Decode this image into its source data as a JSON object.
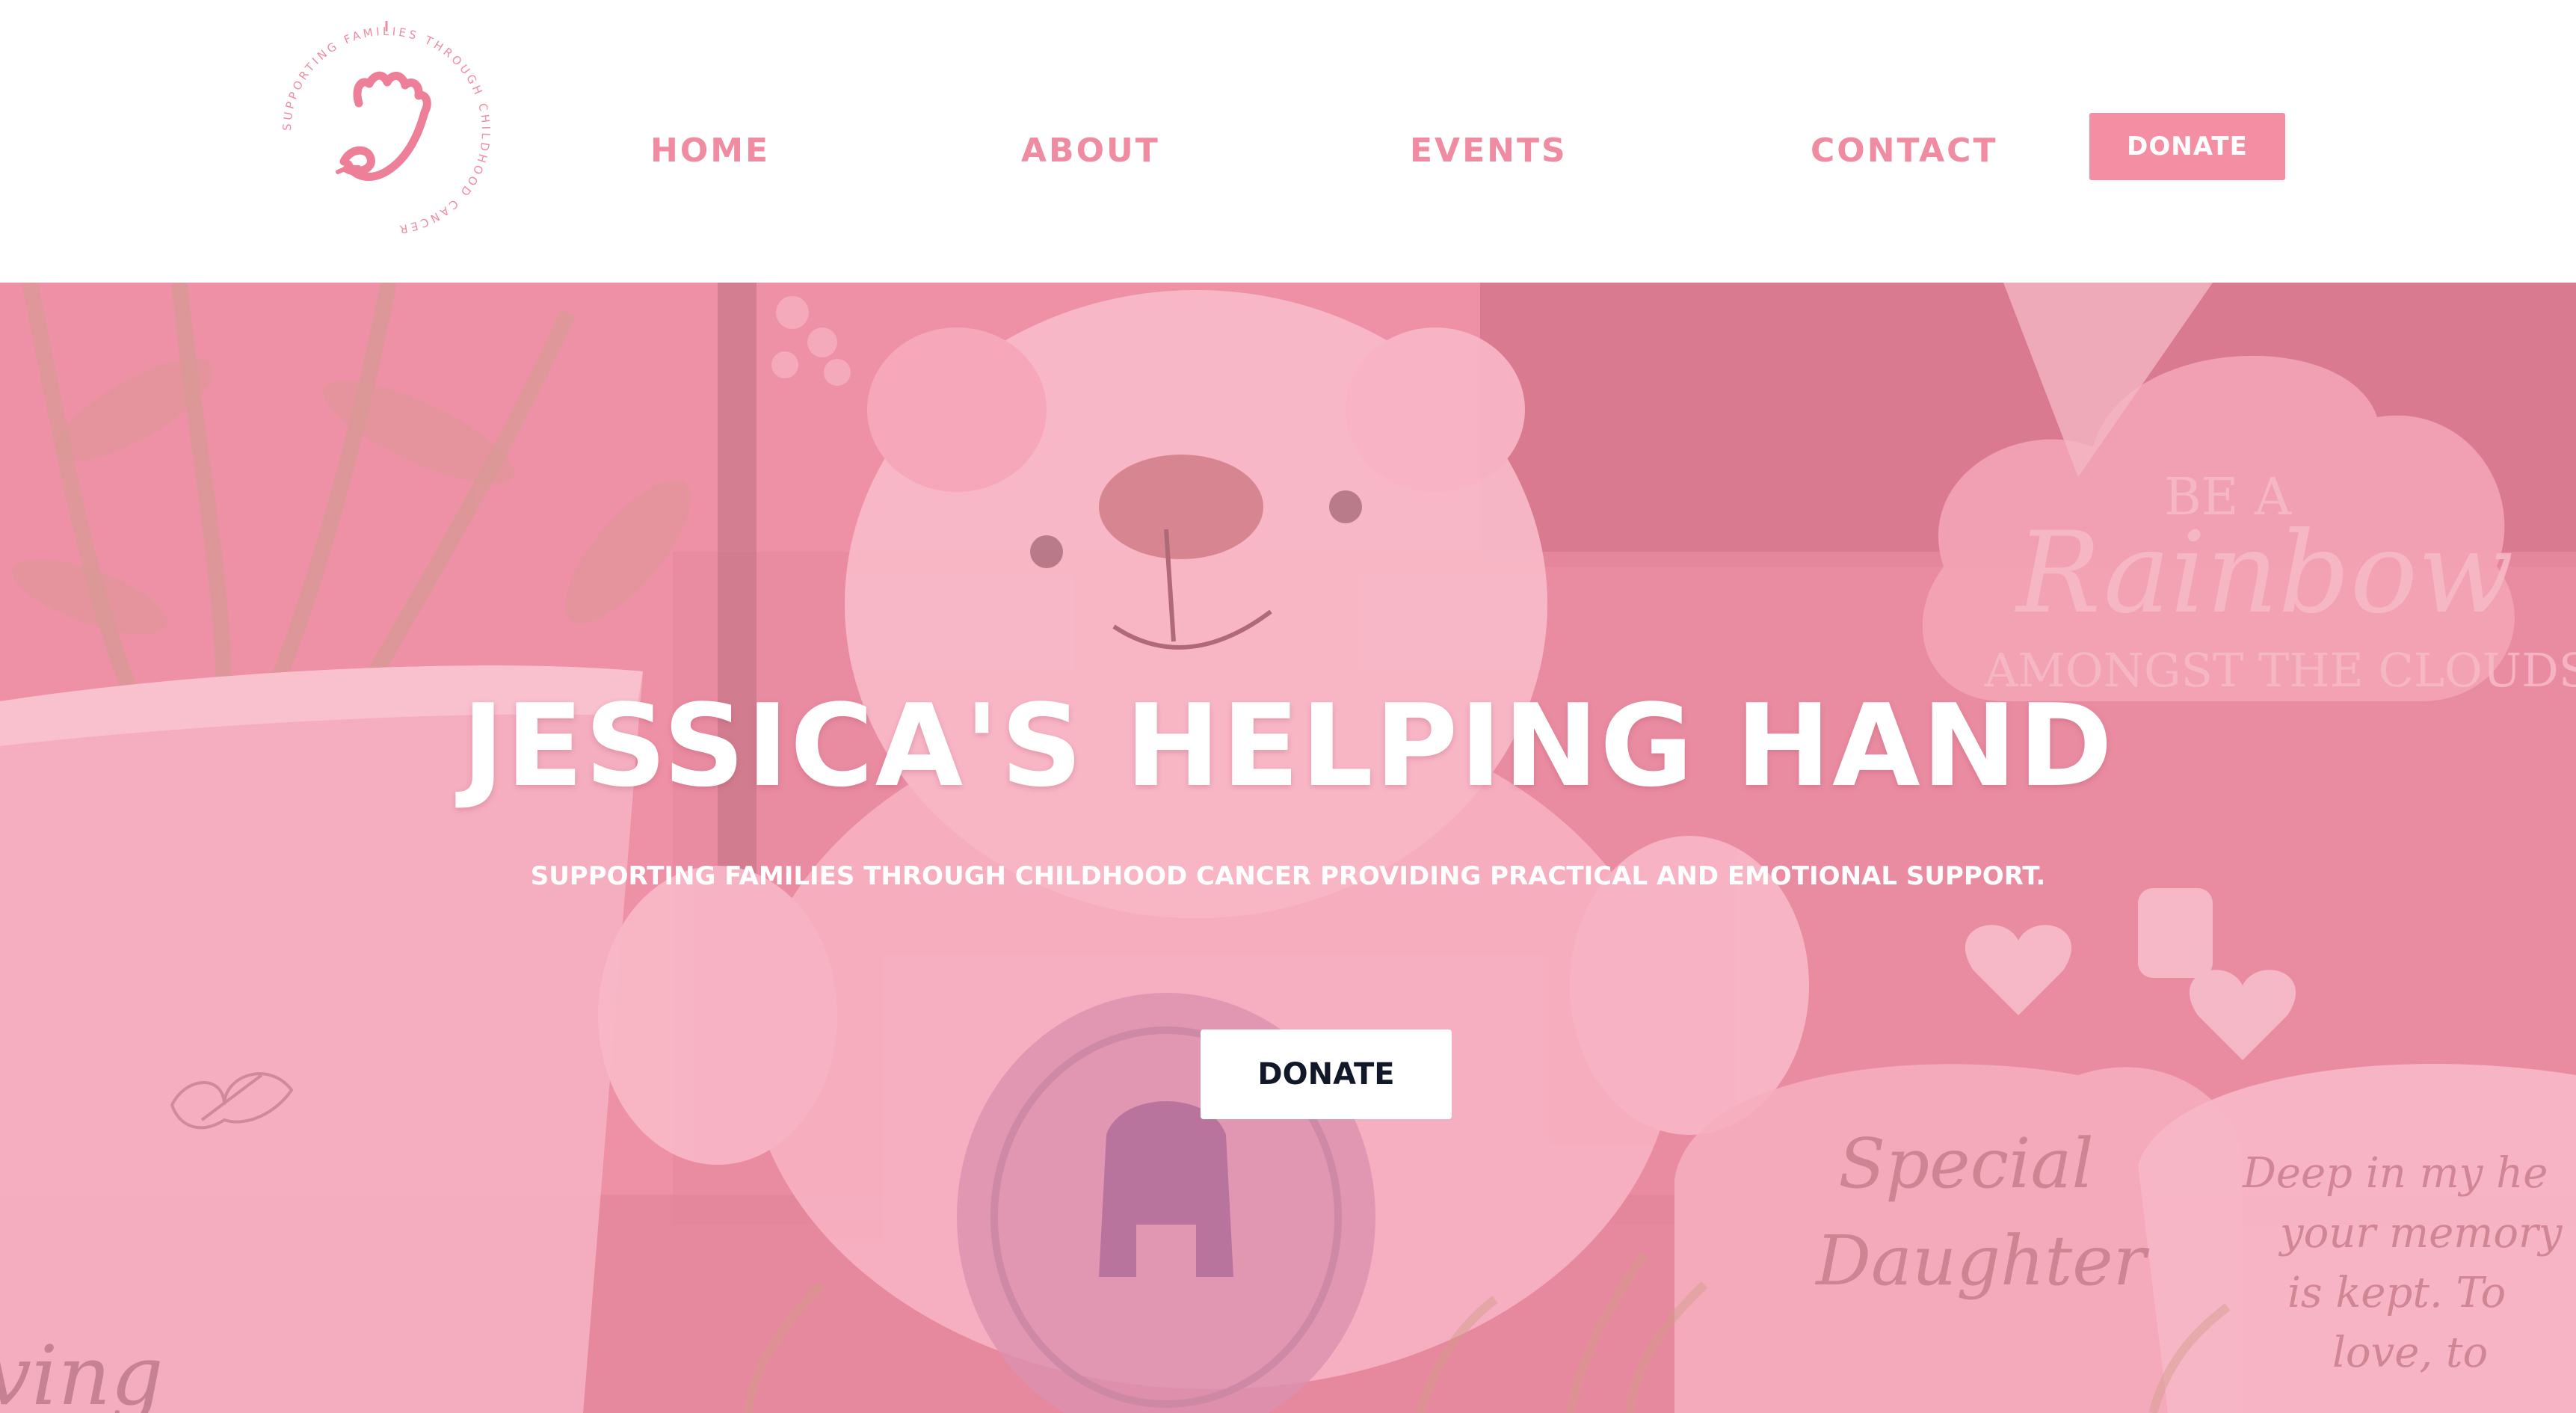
{
  "colors": {
    "brand_pink": "#f38ea3",
    "nav_text": "#f08ca2",
    "hero_tint": "#e98a9e",
    "hero_text": "#ffffff",
    "donate_text_dark": "#111827"
  },
  "header": {
    "logo": {
      "icon": "helping-hand-logo-icon",
      "ring_text": "SUPPORTING FAMILIES THROUGH CHILDHOOD CANCER"
    },
    "nav": {
      "home": "HOME",
      "about": "ABOUT",
      "events": "EVENTS",
      "contact": "CONTACT"
    },
    "donate_label": "DONATE"
  },
  "hero": {
    "title": "JESSICA'S HELPING HAND",
    "subtitle": "SUPPORTING FAMILIES THROUGH CHILDHOOD CANCER PROVIDING PRACTICAL AND EMOTIONAL SUPPORT.",
    "donate_label": "DONATE",
    "photo": {
      "plaque_1": {
        "line1": "BE A",
        "line2": "Rainbow",
        "line3": "AMONGST THE CLOUDS"
      },
      "plaque_2": {
        "line1": "Special",
        "line2": "Daughter"
      },
      "plaque_3": {
        "line1": "Deep in my he",
        "line2": "your memory",
        "line3": "is kept. To",
        "line4": "love, to"
      },
      "vase_text": "ving"
    }
  }
}
